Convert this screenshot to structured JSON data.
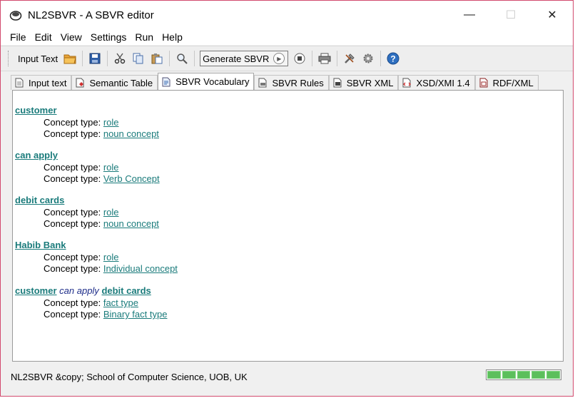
{
  "window": {
    "title": "NL2SBVR - A SBVR editor",
    "controls": {
      "minimize": "—",
      "maximize": "☐",
      "close": "✕"
    }
  },
  "menu": [
    "File",
    "Edit",
    "View",
    "Settings",
    "Run",
    "Help"
  ],
  "toolbar": {
    "input_text_label": "Input Text",
    "generate_label": "Generate SBVR"
  },
  "tabs": [
    {
      "label": "Input text",
      "icon": "document-icon"
    },
    {
      "label": "Semantic Table",
      "icon": "table-document-icon"
    },
    {
      "label": "SBVR Vocabulary",
      "icon": "vocabulary-icon",
      "active": true
    },
    {
      "label": "SBVR Rules",
      "icon": "rules-icon"
    },
    {
      "label": "SBVR XML",
      "icon": "xml-icon"
    },
    {
      "label": "XSD/XMI 1.4",
      "icon": "xsd-icon"
    },
    {
      "label": "RDF/XML",
      "icon": "rdf-icon"
    }
  ],
  "vocabulary": {
    "concept_type_label": "Concept type:",
    "entries": [
      {
        "term": "customer",
        "types": [
          "role",
          "noun concept"
        ]
      },
      {
        "term": "can apply",
        "types": [
          "role",
          "Verb Concept"
        ]
      },
      {
        "term": "debit cards",
        "types": [
          "role",
          "noun concept"
        ]
      },
      {
        "term": "Habib Bank",
        "types": [
          "role",
          "Individual concept"
        ]
      }
    ],
    "fact": {
      "subject": "customer",
      "verb": "can apply",
      "object": "debit cards",
      "types": [
        "fact type",
        "Binary fact type"
      ]
    }
  },
  "status": {
    "text": "NL2SBVR &copy; School of Computer Science, UOB, UK",
    "progress_fraction": 1.0
  },
  "colors": {
    "term": "#1a7b7b",
    "verb": "#1f2e8a",
    "window_border": "#d24a6e",
    "progress": "#5cbf5c"
  }
}
